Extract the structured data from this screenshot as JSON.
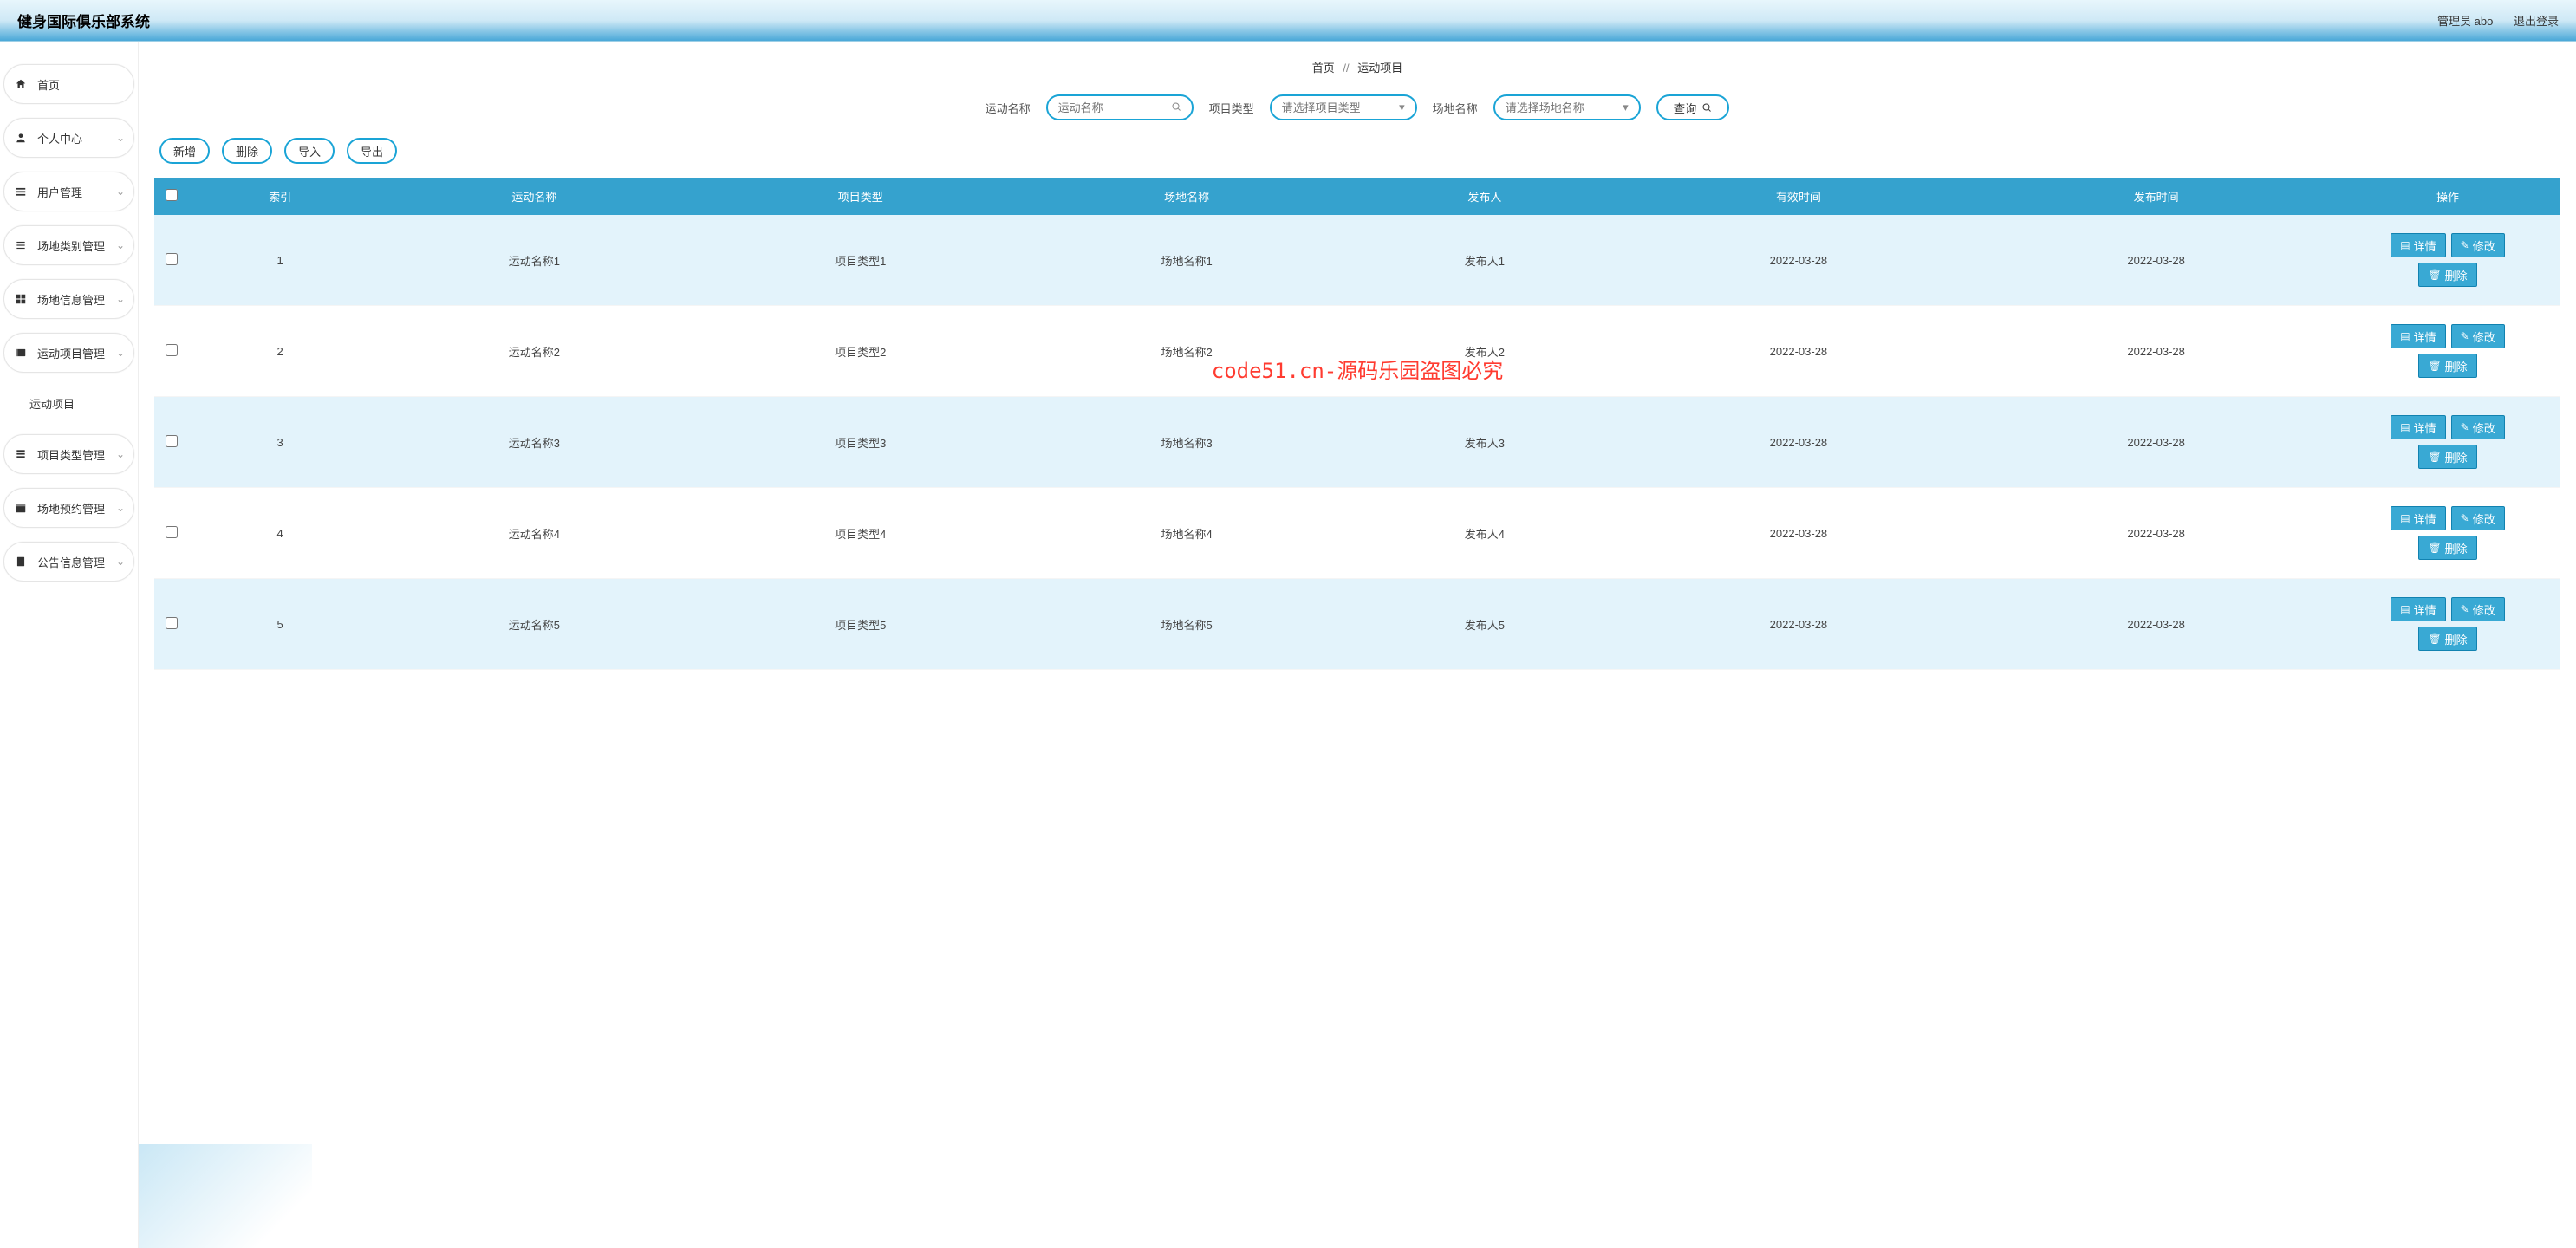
{
  "header": {
    "title": "健身国际俱乐部系统",
    "user_label": "管理员 abo",
    "logout": "退出登录"
  },
  "sidebar": {
    "items": [
      {
        "icon": "home",
        "label": "首页",
        "expandable": false
      },
      {
        "icon": "user",
        "label": "个人中心",
        "expandable": true
      },
      {
        "icon": "list",
        "label": "用户管理",
        "expandable": true
      },
      {
        "icon": "grid",
        "label": "场地类别管理",
        "expandable": true
      },
      {
        "icon": "tiles",
        "label": "场地信息管理",
        "expandable": true
      },
      {
        "icon": "film",
        "label": "运动项目管理",
        "expandable": true,
        "sub": "运动项目"
      },
      {
        "icon": "bars",
        "label": "项目类型管理",
        "expandable": true
      },
      {
        "icon": "cal",
        "label": "场地预约管理",
        "expandable": true
      },
      {
        "icon": "doc",
        "label": "公告信息管理",
        "expandable": true
      }
    ]
  },
  "breadcrumb": {
    "home": "首页",
    "sep": "//",
    "current": "运动项目"
  },
  "filters": {
    "name_label": "运动名称",
    "name_placeholder": "运动名称",
    "type_label": "项目类型",
    "type_placeholder": "请选择项目类型",
    "venue_label": "场地名称",
    "venue_placeholder": "请选择场地名称",
    "search_btn": "查询"
  },
  "actions": {
    "add": "新增",
    "delete": "删除",
    "import": "导入",
    "export": "导出"
  },
  "table": {
    "headers": [
      "索引",
      "运动名称",
      "项目类型",
      "场地名称",
      "发布人",
      "有效时间",
      "发布时间",
      "操作"
    ],
    "op_labels": {
      "detail": "详情",
      "edit": "修改",
      "delete": "删除"
    },
    "rows": [
      {
        "idx": "1",
        "name": "运动名称1",
        "type": "项目类型1",
        "venue": "场地名称1",
        "author": "发布人1",
        "valid": "2022-03-28",
        "pub": "2022-03-28"
      },
      {
        "idx": "2",
        "name": "运动名称2",
        "type": "项目类型2",
        "venue": "场地名称2",
        "author": "发布人2",
        "valid": "2022-03-28",
        "pub": "2022-03-28"
      },
      {
        "idx": "3",
        "name": "运动名称3",
        "type": "项目类型3",
        "venue": "场地名称3",
        "author": "发布人3",
        "valid": "2022-03-28",
        "pub": "2022-03-28"
      },
      {
        "idx": "4",
        "name": "运动名称4",
        "type": "项目类型4",
        "venue": "场地名称4",
        "author": "发布人4",
        "valid": "2022-03-28",
        "pub": "2022-03-28"
      },
      {
        "idx": "5",
        "name": "运动名称5",
        "type": "项目类型5",
        "venue": "场地名称5",
        "author": "发布人5",
        "valid": "2022-03-28",
        "pub": "2022-03-28"
      }
    ]
  },
  "watermark": "code51.cn-源码乐园盗图必究"
}
